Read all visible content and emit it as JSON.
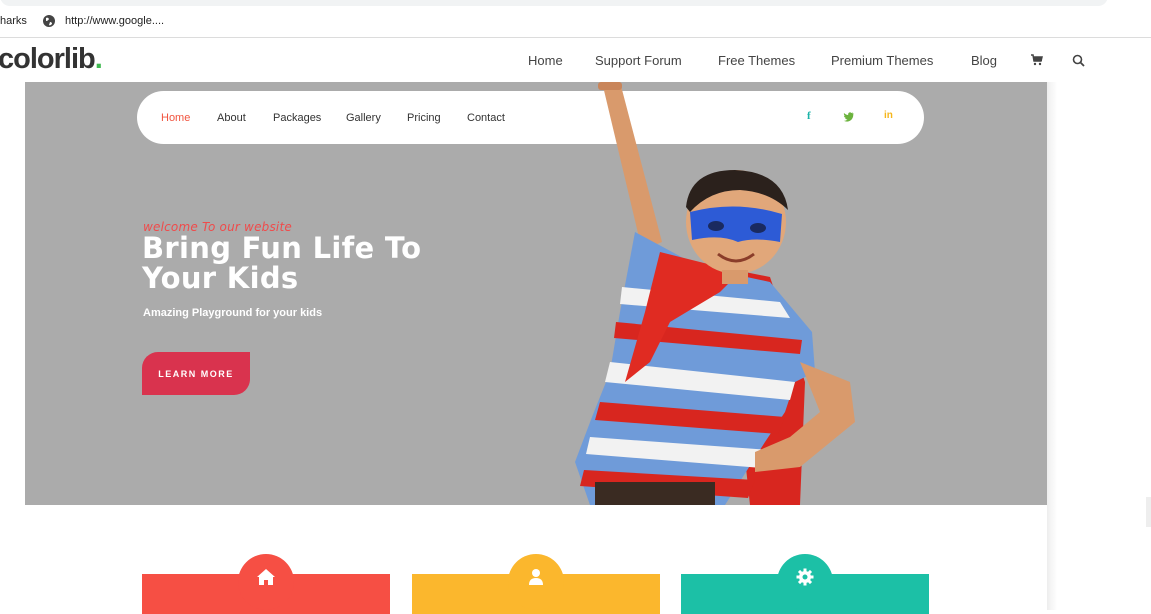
{
  "browser": {
    "bookmarks_label": "harks",
    "bookmark_link": "http://www.google...."
  },
  "colorlib": {
    "logo_text": "colorlib",
    "logo_dot": ".",
    "nav": [
      "Home",
      "Support Forum",
      "Free Themes",
      "Premium Themes",
      "Blog"
    ],
    "icons": [
      "cart-icon",
      "search-icon"
    ]
  },
  "preview": {
    "nav": {
      "items": [
        "Home",
        "About",
        "Packages",
        "Gallery",
        "Pricing",
        "Contact"
      ],
      "active": "Home",
      "social": {
        "facebook": "f",
        "twitter": "twitter-icon",
        "linkedin": "in"
      }
    },
    "hero": {
      "welcome": "welcome To our website",
      "headline_line1": "Bring Fun Life To",
      "headline_line2": "Your Kids",
      "subline": "Amazing Playground for your kids",
      "cta": "LEARN MORE"
    },
    "features": [
      {
        "icon": "home-icon",
        "color": "#f64f44"
      },
      {
        "icon": "user-icon",
        "color": "#fbb72d"
      },
      {
        "icon": "gear-icon",
        "color": "#1cc0a6"
      }
    ],
    "colors": {
      "accent_red": "#d9334e",
      "active_nav": "#f1543f",
      "hero_bg": "#ababab"
    }
  }
}
